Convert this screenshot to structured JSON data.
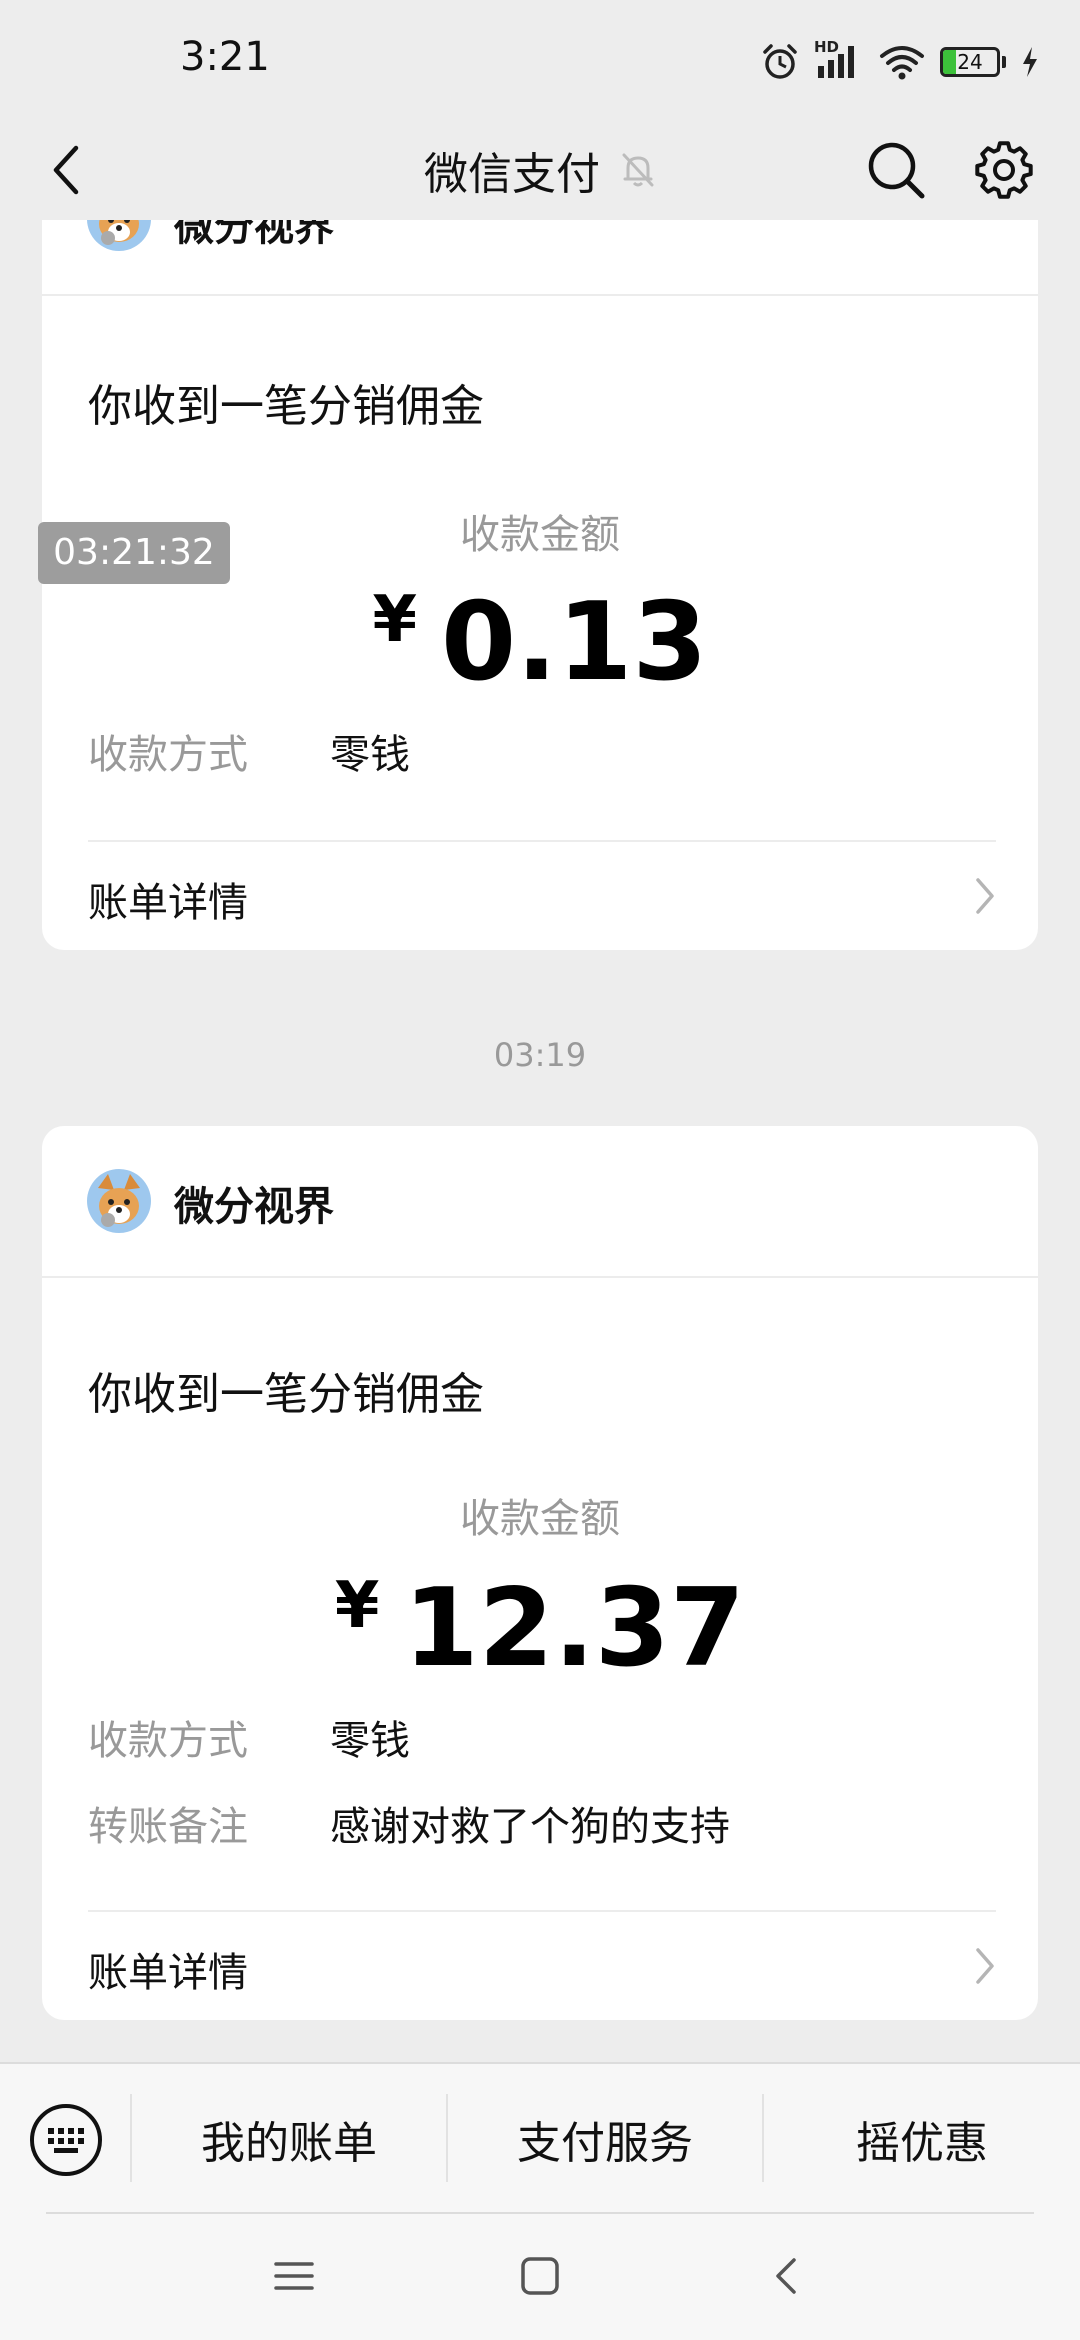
{
  "status_bar": {
    "time": "3:21",
    "network": "HD",
    "battery": "24",
    "battery_percent": 24
  },
  "header": {
    "title": "微信支付",
    "back_icon": "chevron-left-icon",
    "mute_icon": "bell-muted-icon",
    "search_icon": "search-icon",
    "settings_icon": "gear-icon"
  },
  "overlay_timestamp": "03:21:32",
  "messages": [
    {
      "sender": "微分视界",
      "title": "你收到一笔分销佣金",
      "amount_label": "收款金额",
      "currency": "¥",
      "amount": "0.13",
      "fields": [
        {
          "label": "收款方式",
          "value": "零钱"
        }
      ],
      "detail_label": "账单详情"
    },
    {
      "time": "03:19",
      "sender": "微分视界",
      "title": "你收到一笔分销佣金",
      "amount_label": "收款金额",
      "currency": "¥",
      "amount": "12.37",
      "fields": [
        {
          "label": "收款方式",
          "value": "零钱"
        },
        {
          "label": "转账备注",
          "value": "感谢对救了个狗的支持"
        }
      ],
      "detail_label": "账单详情"
    }
  ],
  "bottom_menu": {
    "keyboard_icon": "keyboard-icon",
    "items": [
      {
        "label": "我的账单"
      },
      {
        "label": "支付服务"
      },
      {
        "label": "摇优惠"
      }
    ]
  },
  "system_nav": {
    "icons": [
      "menu-icon",
      "home-icon",
      "back-icon"
    ]
  },
  "colors": {
    "background": "#ededed",
    "card": "#ffffff",
    "muted_text": "#999999",
    "battery_green": "#3cc13a"
  }
}
